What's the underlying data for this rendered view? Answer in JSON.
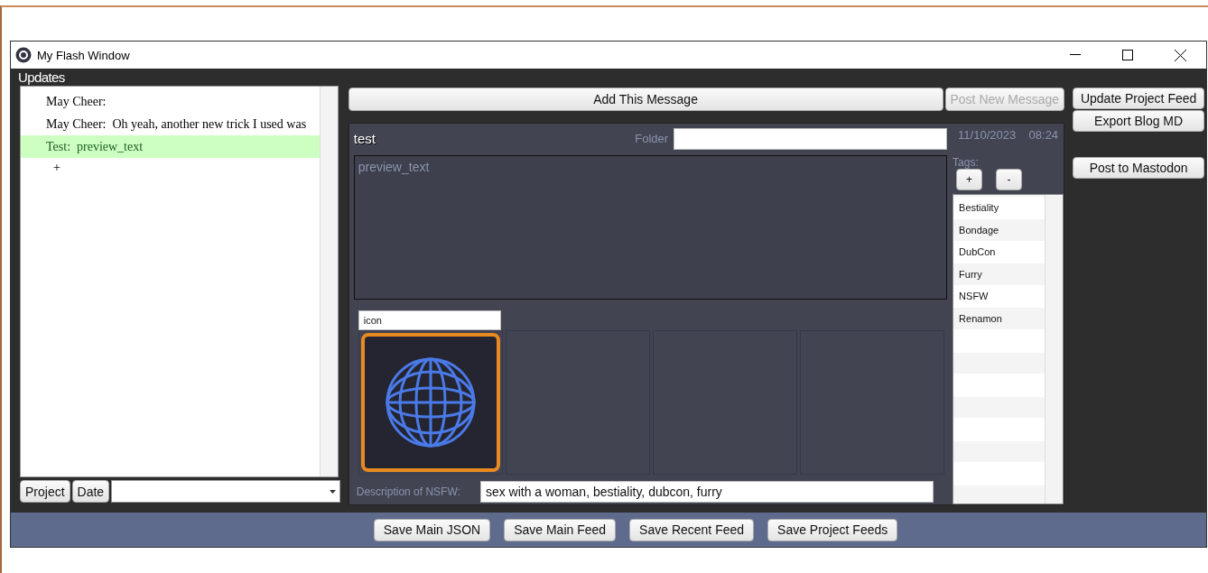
{
  "window": {
    "title": "My Flash Window"
  },
  "updates": {
    "label": "Updates",
    "items": [
      {
        "author": "May Cheer:",
        "selected": false
      },
      {
        "author": "May Cheer:",
        "text": "Oh yeah, another new trick I used was",
        "selected": false
      },
      {
        "author": "Test:",
        "text": "preview_text",
        "selected": true
      }
    ],
    "add_label": "+",
    "sort_buttons": [
      "Project",
      "Date"
    ]
  },
  "actions": [
    {
      "label": "Add This Message",
      "disabled": false
    },
    {
      "label": "Post New Message",
      "disabled": true
    }
  ],
  "side_buttons": [
    "Update Project Feed",
    "Export Blog MD",
    "Post to Mastodon"
  ],
  "editor": {
    "title": "test",
    "folder_label": "Folder",
    "date": "11/10/2023",
    "time": "08:24",
    "preview": "preview_text",
    "image_label": "icon",
    "description_label": "Description of NSFW:",
    "description": "sex with a woman, bestiality, dubcon, furry",
    "tags_label": "Tags:",
    "tag_buttons": [
      "+",
      "-"
    ],
    "tags": [
      "Bestiality",
      "Bondage",
      "DubCon",
      "Furry",
      "NSFW",
      "Renamon"
    ]
  },
  "footer_buttons": [
    "Save Main JSON",
    "Save Main Feed",
    "Save Recent Feed",
    "Save Project Feeds"
  ]
}
